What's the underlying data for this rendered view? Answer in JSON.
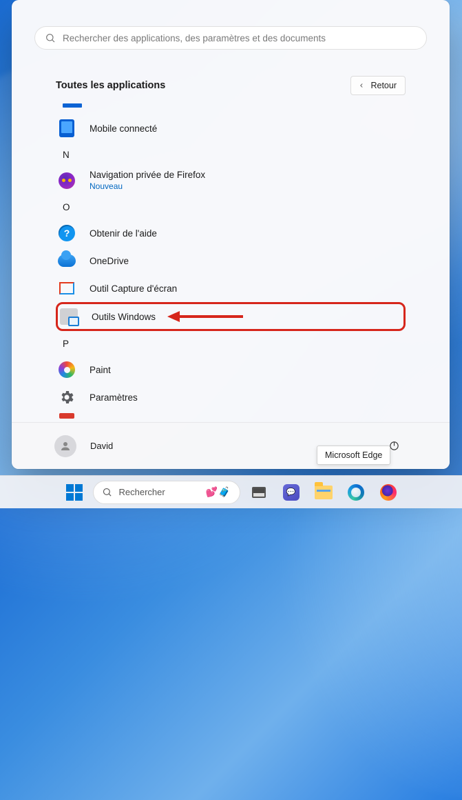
{
  "search": {
    "placeholder": "Rechercher des applications, des paramètres et des documents"
  },
  "header": {
    "title": "Toutes les applications",
    "back_label": "Retour"
  },
  "letters": {
    "n": "N",
    "o": "O",
    "p": "P"
  },
  "apps": {
    "mobile": {
      "label": "Mobile connecté"
    },
    "firefox_priv": {
      "label": "Navigation privée de Firefox",
      "sub": "Nouveau"
    },
    "help": {
      "label": "Obtenir de l'aide"
    },
    "onedrive": {
      "label": "OneDrive"
    },
    "snip": {
      "label": "Outil Capture d'écran"
    },
    "tools": {
      "label": "Outils Windows"
    },
    "paint": {
      "label": "Paint"
    },
    "settings": {
      "label": "Paramètres"
    }
  },
  "footer": {
    "user_name": "David"
  },
  "tooltip": {
    "text": "Microsoft Edge"
  },
  "taskbar": {
    "search_label": "Rechercher"
  }
}
